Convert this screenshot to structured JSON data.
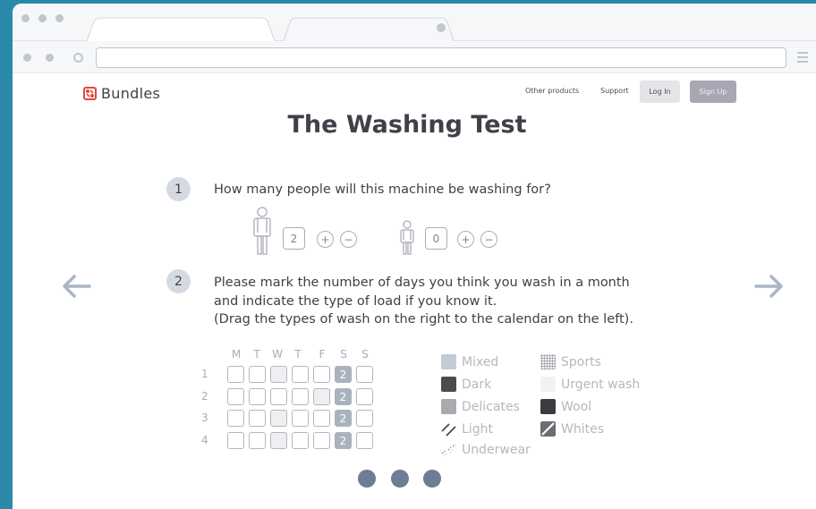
{
  "browser": {
    "url": ""
  },
  "header": {
    "logo_text": "Bundles",
    "nav": {
      "other_products": "Other products",
      "support": "Support"
    },
    "login_label": "Log In",
    "signup_label": "Sign Up"
  },
  "page": {
    "title": "The Washing Test"
  },
  "question1": {
    "number": "1",
    "text": "How many people will this machine be washing for?",
    "adults_count": "2",
    "children_count": "0",
    "plus": "+",
    "minus": "−"
  },
  "question2": {
    "number": "2",
    "line1": "Please mark the number of days you think you wash in a month",
    "line2": "and indicate the type of load if you know it.",
    "line3": "(Drag the types of wash on the right to the calendar on the left)."
  },
  "calendar": {
    "days": [
      "M",
      "T",
      "W",
      "T",
      "F",
      "S",
      "S"
    ],
    "weeks": [
      "1",
      "2",
      "3",
      "4"
    ],
    "marked_value": "2"
  },
  "legend": {
    "mixed": "Mixed",
    "dark": "Dark",
    "delicates": "Delicates",
    "light": "Light",
    "underwear": "Underwear",
    "sports": "Sports",
    "urgent": "Urgent wash",
    "wool": "Wool",
    "whites": "Whites"
  },
  "colors": {
    "background": "#2a89aa",
    "text": "#3f4148",
    "pager": "#6e7c96",
    "logo": "#e1493b"
  }
}
